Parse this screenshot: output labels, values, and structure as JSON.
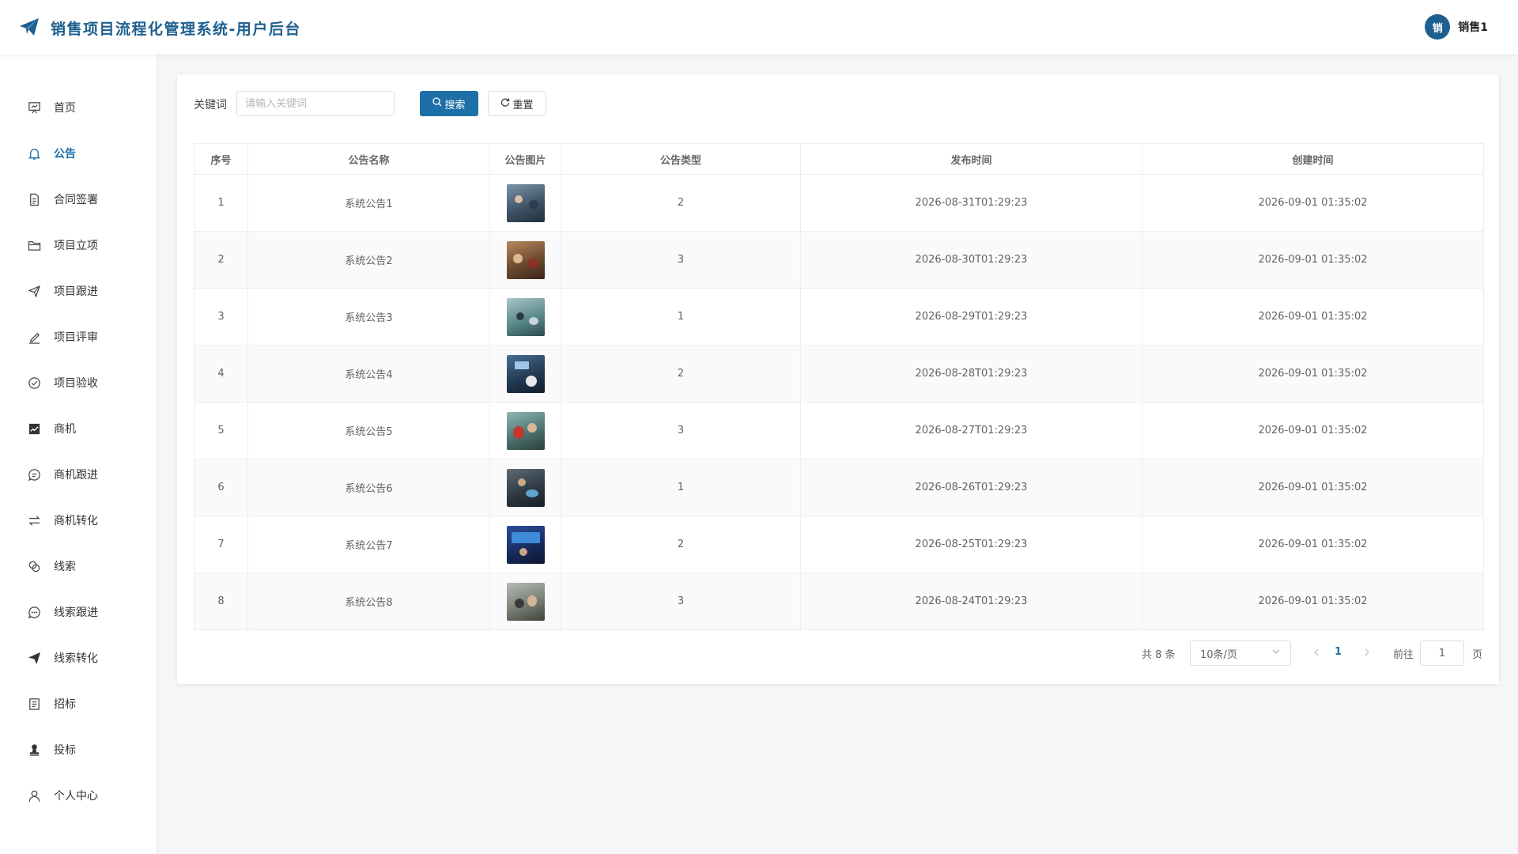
{
  "header": {
    "title": "销售项目流程化管理系统-用户后台",
    "avatar_text": "销",
    "user_name": "销售1"
  },
  "sidebar": {
    "items": [
      {
        "label": "首页",
        "icon": "presentation-icon"
      },
      {
        "label": "公告",
        "icon": "bell-icon",
        "active": true
      },
      {
        "label": "合同签署",
        "icon": "document-icon"
      },
      {
        "label": "项目立项",
        "icon": "folder-icon"
      },
      {
        "label": "项目跟进",
        "icon": "send-icon"
      },
      {
        "label": "项目评审",
        "icon": "edit-pen-icon"
      },
      {
        "label": "项目验收",
        "icon": "check-circle-icon"
      },
      {
        "label": "商机",
        "icon": "chart-icon"
      },
      {
        "label": "商机跟进",
        "icon": "chat-bubble-icon"
      },
      {
        "label": "商机转化",
        "icon": "switch-icon"
      },
      {
        "label": "线索",
        "icon": "link-icon"
      },
      {
        "label": "线索跟进",
        "icon": "chat-dots-icon"
      },
      {
        "label": "线索转化",
        "icon": "paper-plane-filled-icon"
      },
      {
        "label": "招标",
        "icon": "list-document-icon"
      },
      {
        "label": "投标",
        "icon": "stamp-icon"
      },
      {
        "label": "个人中心",
        "icon": "user-icon"
      }
    ]
  },
  "search": {
    "label": "关键词",
    "placeholder": "请输入关键词",
    "value": "",
    "search_button": "搜索",
    "reset_button": "重置"
  },
  "table": {
    "columns": [
      "序号",
      "公告名称",
      "公告图片",
      "公告类型",
      "发布时间",
      "创建时间"
    ],
    "rows": [
      {
        "index": "1",
        "name": "系统公告1",
        "type": "2",
        "publish_time": "2026-08-31T01:29:23",
        "create_time": "2026-09-01 01:35:02"
      },
      {
        "index": "2",
        "name": "系统公告2",
        "type": "3",
        "publish_time": "2026-08-30T01:29:23",
        "create_time": "2026-09-01 01:35:02"
      },
      {
        "index": "3",
        "name": "系统公告3",
        "type": "1",
        "publish_time": "2026-08-29T01:29:23",
        "create_time": "2026-09-01 01:35:02"
      },
      {
        "index": "4",
        "name": "系统公告4",
        "type": "2",
        "publish_time": "2026-08-28T01:29:23",
        "create_time": "2026-09-01 01:35:02"
      },
      {
        "index": "5",
        "name": "系统公告5",
        "type": "3",
        "publish_time": "2026-08-27T01:29:23",
        "create_time": "2026-09-01 01:35:02"
      },
      {
        "index": "6",
        "name": "系统公告6",
        "type": "1",
        "publish_time": "2026-08-26T01:29:23",
        "create_time": "2026-09-01 01:35:02"
      },
      {
        "index": "7",
        "name": "系统公告7",
        "type": "2",
        "publish_time": "2026-08-25T01:29:23",
        "create_time": "2026-09-01 01:35:02"
      },
      {
        "index": "8",
        "name": "系统公告8",
        "type": "3",
        "publish_time": "2026-08-24T01:29:23",
        "create_time": "2026-09-01 01:35:02"
      }
    ]
  },
  "pagination": {
    "total_text": "共 8 条",
    "page_size": "10条/页",
    "current_page": "1",
    "goto_label": "前往",
    "goto_value": "1",
    "goto_suffix": "页"
  },
  "colors": {
    "primary": "#1d6fa8",
    "title": "#1d5f8f",
    "background": "#f5f6f8"
  }
}
